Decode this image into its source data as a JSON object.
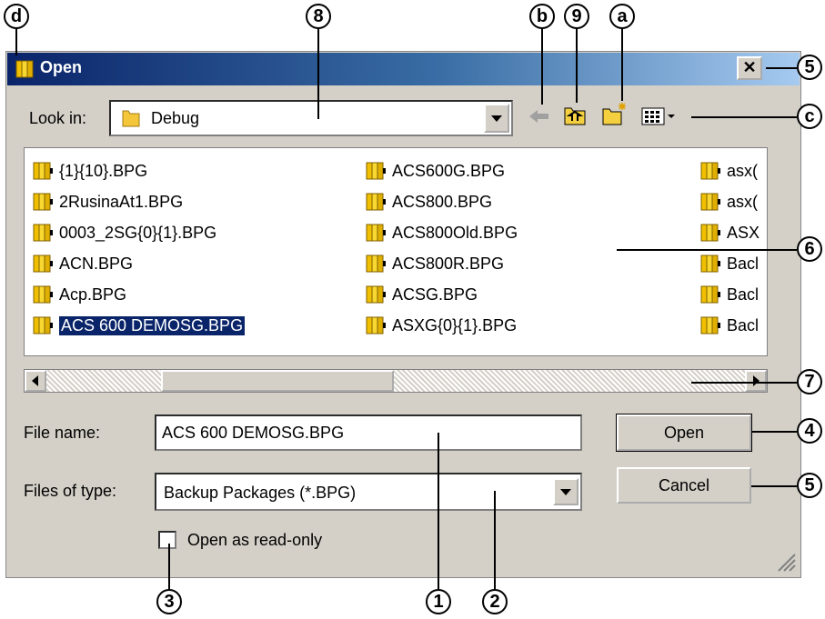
{
  "dialog": {
    "title": "Open",
    "close_glyph": "✕",
    "look_in_label": "Look in:",
    "look_in_value": "Debug",
    "file_name_label": "File name:",
    "file_name_value": "ACS 600 DEMOSG.BPG",
    "files_of_type_label": "Files of type:",
    "files_of_type_value": "Backup Packages (*.BPG)",
    "read_only_label": "Open as read-only",
    "read_only_checked": false,
    "open_button": "Open",
    "cancel_button": "Cancel"
  },
  "files": {
    "col1": [
      "{1}{10}.BPG",
      "2RusinaAt1.BPG",
      "0003_2SG{0}{1}.BPG",
      "ACN.BPG",
      "Acp.BPG",
      "ACS 600 DEMOSG.BPG"
    ],
    "col2": [
      "ACS600G.BPG",
      "ACS800.BPG",
      "ACS800Old.BPG",
      "ACS800R.BPG",
      "ACSG.BPG",
      "ASXG{0}{1}.BPG"
    ],
    "col3": [
      "asx(",
      "asx(",
      "ASX",
      "Bacl",
      "Bacl",
      "Bacl"
    ],
    "selected": "ACS 600 DEMOSG.BPG"
  },
  "callouts": {
    "d": "d",
    "8": "8",
    "b": "b",
    "9": "9",
    "a": "a",
    "5a": "5",
    "c": "c",
    "6": "6",
    "7": "7",
    "4": "4",
    "5b": "5",
    "3": "3",
    "1": "1",
    "2": "2"
  },
  "colors": {
    "title_start": "#0a246a",
    "title_end": "#a6caf0",
    "selection": "#0a246a",
    "dialog_bg": "#d4d0c8"
  },
  "icons": [
    "package-icon",
    "folder-icon",
    "back-arrow-icon",
    "up-folder-icon",
    "new-folder-icon",
    "view-menu-icon"
  ]
}
